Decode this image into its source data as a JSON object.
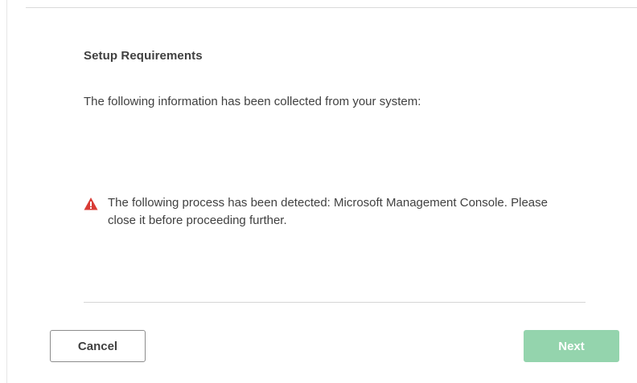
{
  "dialog": {
    "title": "Setup Requirements",
    "info_text": "The following information has been collected from your system:",
    "warning": {
      "icon": "warning-triangle-icon",
      "text": "The following process has been detected: Microsoft Management Console. Please close it before proceeding further."
    }
  },
  "buttons": {
    "cancel_label": "Cancel",
    "next_label": "Next",
    "next_enabled": false
  },
  "colors": {
    "warning_icon": "#d93b35",
    "next_button_disabled": "#94d4ad",
    "text": "#404040"
  }
}
